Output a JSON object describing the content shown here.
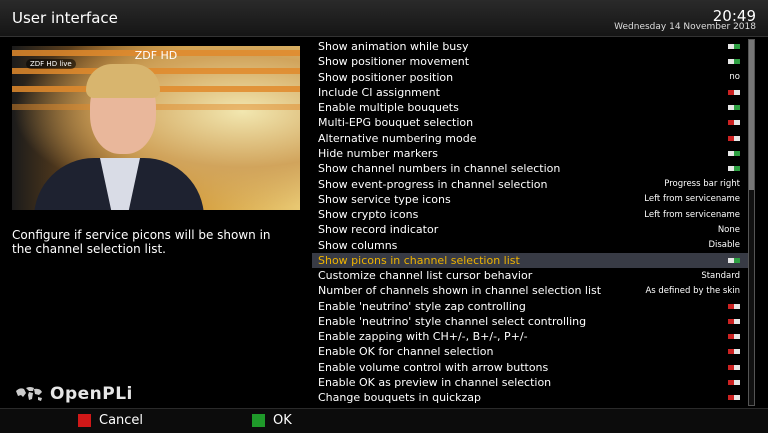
{
  "header": {
    "title": "User interface",
    "time": "20:49",
    "date": "Wednesday 14 November 2018"
  },
  "preview": {
    "channel": "ZDF HD",
    "logo": "ZDF HD live"
  },
  "description": "Configure if service picons will be shown in the channel selection list.",
  "brand": {
    "name": "OpenPLi"
  },
  "settings": [
    {
      "label": "Show animation while busy",
      "kind": "toggle",
      "state": "on"
    },
    {
      "label": "Show positioner movement",
      "kind": "toggle",
      "state": "on"
    },
    {
      "label": "Show positioner position",
      "kind": "text",
      "value": "no"
    },
    {
      "label": "Include CI assignment",
      "kind": "toggle",
      "state": "off"
    },
    {
      "label": "Enable multiple bouquets",
      "kind": "toggle",
      "state": "on"
    },
    {
      "label": "Multi-EPG bouquet selection",
      "kind": "toggle",
      "state": "off"
    },
    {
      "label": "Alternative numbering mode",
      "kind": "toggle",
      "state": "off"
    },
    {
      "label": "Hide number markers",
      "kind": "toggle",
      "state": "on"
    },
    {
      "label": "Show channel numbers in channel selection",
      "kind": "toggle",
      "state": "on"
    },
    {
      "label": "Show event-progress in channel selection",
      "kind": "text",
      "value": "Progress bar right"
    },
    {
      "label": "Show service type icons",
      "kind": "text",
      "value": "Left from servicename"
    },
    {
      "label": "Show crypto icons",
      "kind": "text",
      "value": "Left from servicename"
    },
    {
      "label": "Show record indicator",
      "kind": "text",
      "value": "None"
    },
    {
      "label": "Show columns",
      "kind": "text",
      "value": "Disable"
    },
    {
      "label": "Show picons in channel selection list",
      "kind": "toggle",
      "state": "on",
      "selected": true
    },
    {
      "label": "Customize channel list cursor behavior",
      "kind": "text",
      "value": "Standard"
    },
    {
      "label": "Number of channels shown in channel selection list",
      "kind": "text",
      "value": "As defined by the skin"
    },
    {
      "label": "Enable 'neutrino' style zap controlling",
      "kind": "toggle",
      "state": "off"
    },
    {
      "label": "Enable 'neutrino' style channel select controlling",
      "kind": "toggle",
      "state": "off"
    },
    {
      "label": "Enable zapping with CH+/-, B+/-, P+/-",
      "kind": "toggle",
      "state": "off"
    },
    {
      "label": "Enable OK for channel selection",
      "kind": "toggle",
      "state": "off"
    },
    {
      "label": "Enable volume control with arrow buttons",
      "kind": "toggle",
      "state": "off"
    },
    {
      "label": "Enable OK as preview in channel selection",
      "kind": "toggle",
      "state": "off"
    },
    {
      "label": "Change bouquets in quickzap",
      "kind": "toggle",
      "state": "off"
    }
  ],
  "footer": {
    "cancel": {
      "label": "Cancel",
      "color": "#d01818"
    },
    "ok": {
      "label": "OK",
      "color": "#1f9a2a"
    }
  },
  "colors": {
    "toggle_on": "#2ea043",
    "toggle_off": "#cc2222",
    "selected_text": "#f0b400"
  }
}
